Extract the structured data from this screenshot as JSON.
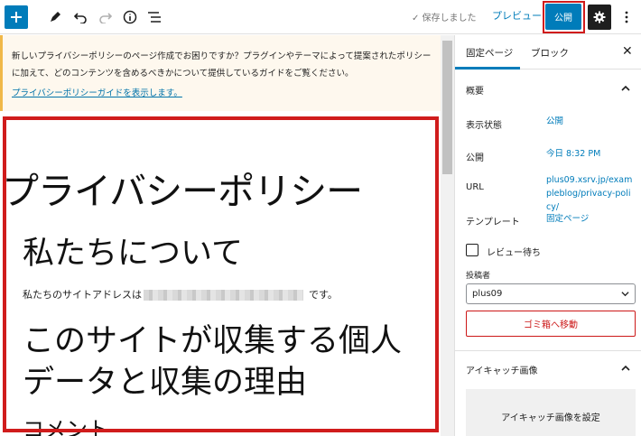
{
  "toolbar": {
    "add_icon": "plus-icon",
    "saved_text": "✓ 保存しました",
    "preview_label": "プレビュー",
    "publish_label": "公開"
  },
  "notice": {
    "text": "新しいプライバシーポリシーのページ作成でお困りですか？プラグインやテーマによって提案されたポリシーに加えて、どのコンテンツを含めるべきかについて提供しているガイドをご覧ください。",
    "link": "プライバシーポリシーガイドを表示します。"
  },
  "editor": {
    "title": "プライバシーポリシー",
    "heading_about": "私たちについて",
    "para_prefix": "私たちのサイトアドレスは",
    "para_suffix": "です。",
    "heading_collect": "このサイトが収集する個人データと収集の理由",
    "heading_next": "コメント"
  },
  "sidebar": {
    "tab_page": "固定ページ",
    "tab_block": "ブロック",
    "summary_title": "概要",
    "visibility_label": "表示状態",
    "visibility_value": "公開",
    "publish_label": "公開",
    "publish_value": "今日 8:32 PM",
    "url_label": "URL",
    "url_value": "plus09.xsrv.jp/exampleblog/privacy-policy/",
    "template_label": "テンプレート",
    "template_value": "固定ページ",
    "pending_review_label": "レビュー待ち",
    "author_label": "投稿者",
    "author_value": "plus09",
    "trash_label": "ゴミ箱へ移動",
    "featured_title": "アイキャッチ画像",
    "featured_button": "アイキャッチ画像を設定"
  }
}
